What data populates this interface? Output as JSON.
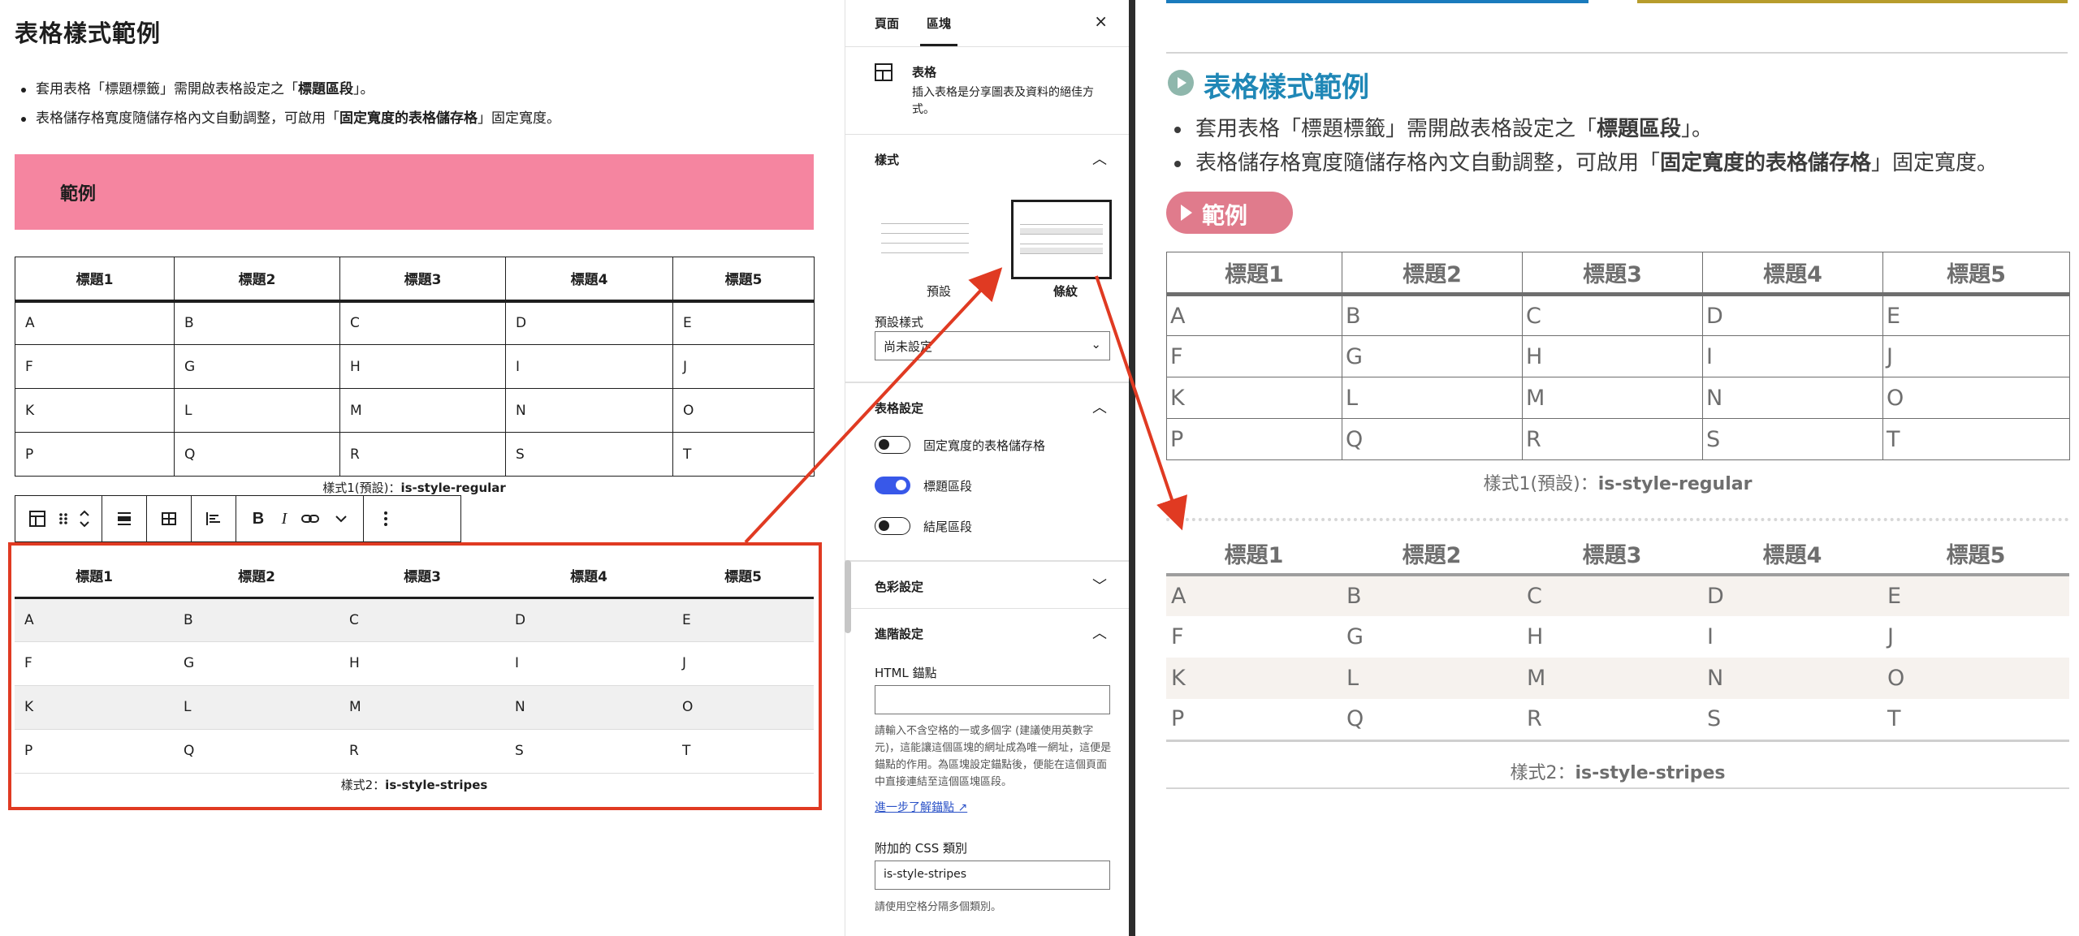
{
  "editor": {
    "title": "表格樣式範例",
    "bullets": [
      {
        "pre": "套用表格「標題標籤」需開啟表格設定之「",
        "bold": "標題區段",
        "post": "」。"
      },
      {
        "pre": "表格儲存格寬度隨儲存格內文自動調整，可啟用「",
        "bold": "固定寬度的表格儲存格",
        "post": "」固定寬度。"
      }
    ],
    "example_label": "範例",
    "table_headers": [
      "標題1",
      "標題2",
      "標題3",
      "標題4",
      "標題5"
    ],
    "table_rows": [
      [
        "A",
        "B",
        "C",
        "D",
        "E"
      ],
      [
        "F",
        "G",
        "H",
        "I",
        "J"
      ],
      [
        "K",
        "L",
        "M",
        "N",
        "O"
      ],
      [
        "P",
        "Q",
        "R",
        "S",
        "T"
      ]
    ],
    "caption1_prefix": "樣式1(預設)：",
    "caption1_code": "is-style-regular",
    "caption2_prefix": "樣式2：",
    "caption2_code": "is-style-stripes",
    "toolbar": {
      "table_icon": "table-icon",
      "drag_icon": "drag-handle-icon",
      "move_icon": "move-up-down-icon",
      "align_icon": "align-icon",
      "edit_table_icon": "edit-table-icon",
      "column_align_icon": "column-align-icon",
      "bold": "B",
      "italic": "I",
      "link_icon": "link-icon",
      "more_rich_icon": "chevron-down-icon",
      "options_icon": "more-vertical-icon"
    }
  },
  "sidebar": {
    "tabs": [
      "頁面",
      "區塊"
    ],
    "active_tab": "區塊",
    "close": "×",
    "block": {
      "name": "表格",
      "description": "插入表格是分享圖表及資料的絕佳方式。"
    },
    "styles_panel": {
      "title": "樣式",
      "options": [
        "預設",
        "條紋"
      ],
      "selected": "條紋",
      "default_style_label": "預設樣式",
      "default_style_value": "尚未設定"
    },
    "table_settings": {
      "title": "表格設定",
      "toggles": [
        {
          "label": "固定寬度的表格儲存格",
          "on": false
        },
        {
          "label": "標題區段",
          "on": true
        },
        {
          "label": "結尾區段",
          "on": false
        }
      ]
    },
    "color_settings": {
      "title": "色彩設定"
    },
    "advanced": {
      "title": "進階設定",
      "html_anchor_label": "HTML 錨點",
      "html_anchor_value": "",
      "html_anchor_help": "請輸入不含空格的一或多個字 (建議使用英數字元)，這能讓這個區塊的網址成為唯一網址，這便是錨點的作用。為區塊設定錨點後，便能在這個頁面中直接連結至這個區塊區段。",
      "learn_more_link": "進一步了解錨點",
      "css_class_label": "附加的 CSS 類別",
      "css_class_value": "is-style-stripes",
      "css_class_help": "請使用空格分隔多個類別。"
    }
  },
  "frontend": {
    "title": "表格樣式範例",
    "bullets": [
      {
        "pre": "套用表格「標題標籤」需開啟表格設定之「",
        "bold": "標題區段",
        "post": "」。"
      },
      {
        "pre": "表格儲存格寬度隨儲存格內文自動調整，可啟用「",
        "bold": "固定寬度的表格儲存格",
        "post": "」固定寬度。"
      }
    ],
    "example_label": "範例",
    "table_headers": [
      "標題1",
      "標題2",
      "標題3",
      "標題4",
      "標題5"
    ],
    "table_rows": [
      [
        "A",
        "B",
        "C",
        "D",
        "E"
      ],
      [
        "F",
        "G",
        "H",
        "I",
        "J"
      ],
      [
        "K",
        "L",
        "M",
        "N",
        "O"
      ],
      [
        "P",
        "Q",
        "R",
        "S",
        "T"
      ]
    ],
    "caption1_prefix": "樣式1(預設)：",
    "caption1_code": "is-style-regular",
    "caption2_prefix": "樣式2：",
    "caption2_code": "is-style-stripes"
  },
  "colors": {
    "annotation_red": "#e03a22",
    "banner_pink": "#f585a0",
    "toggle_blue": "#3858e9",
    "fe_title_blue": "#1f87b6",
    "fe_pill_pink": "#e07b8c",
    "fe_stripe": "#f6f2ee"
  }
}
